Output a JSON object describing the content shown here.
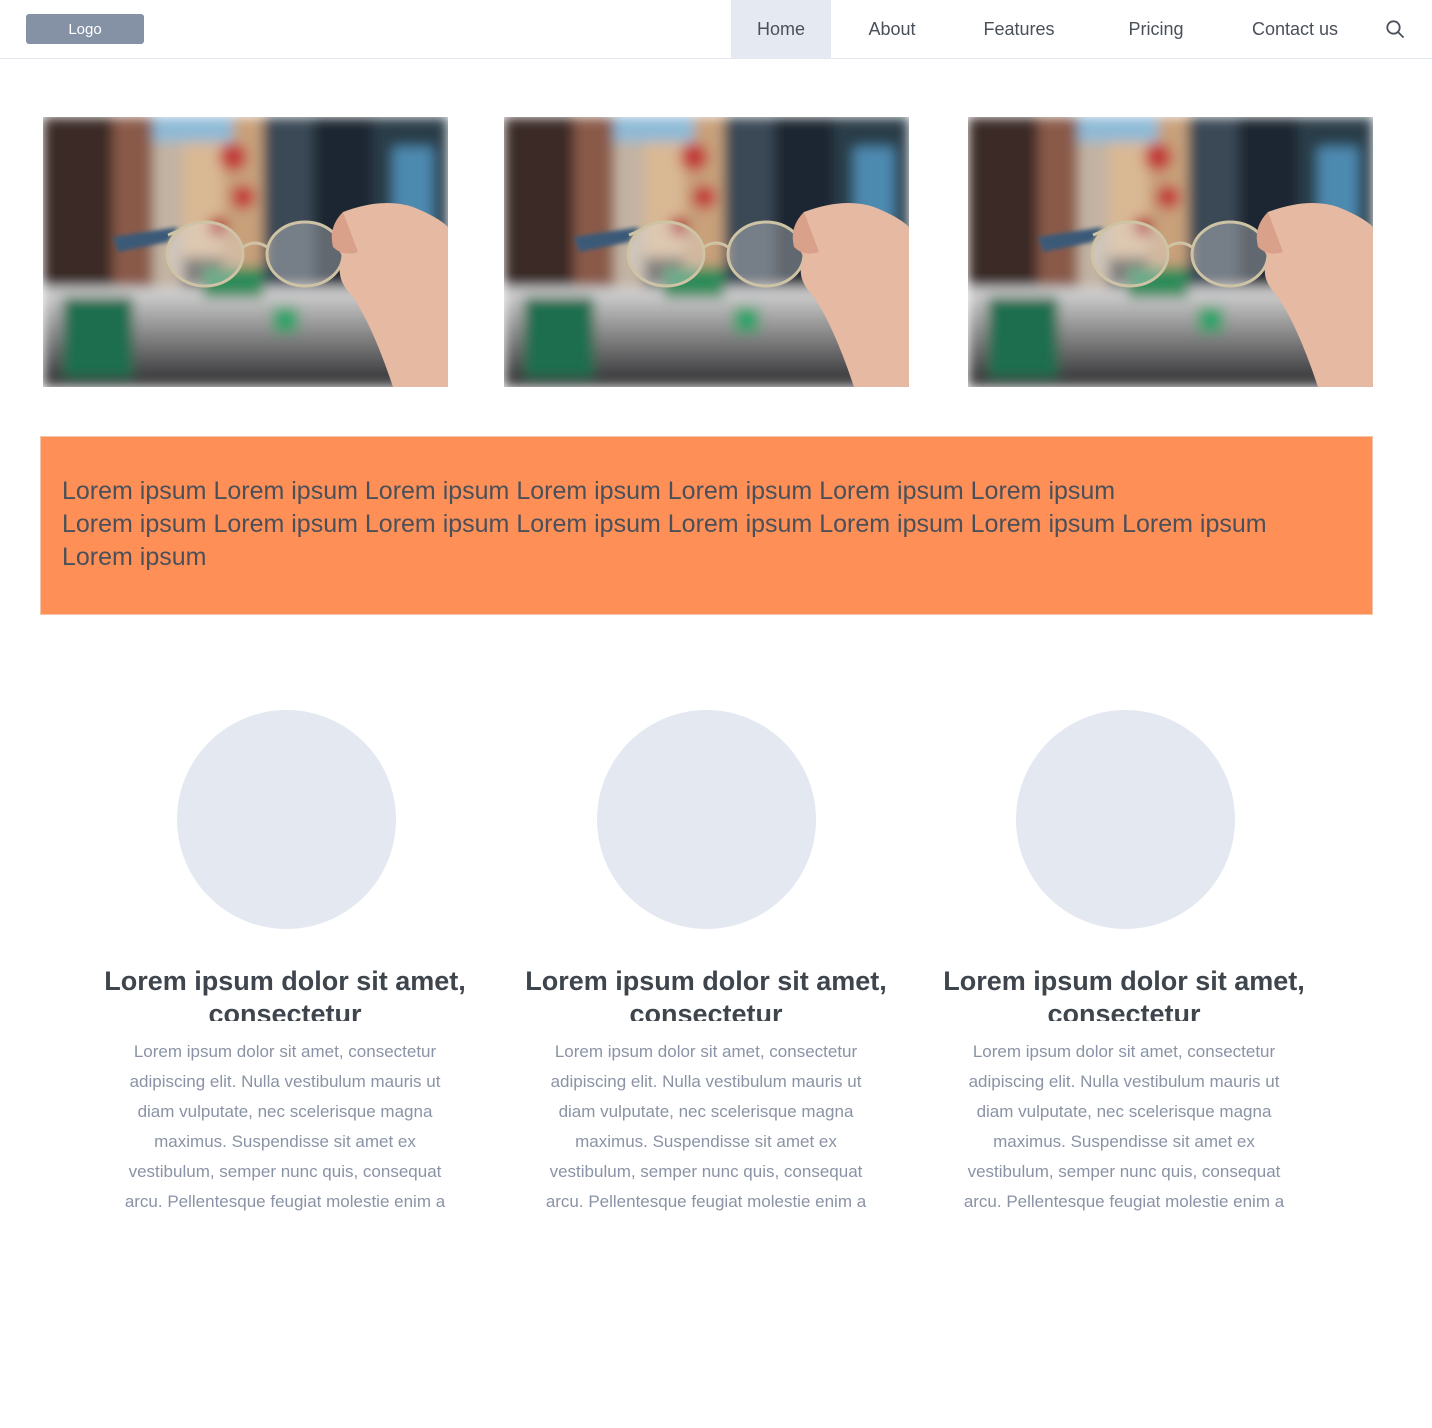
{
  "header": {
    "logo": "Logo",
    "nav": [
      {
        "label": "Home",
        "active": true
      },
      {
        "label": "About",
        "active": false
      },
      {
        "label": "Features",
        "active": false
      },
      {
        "label": "Pricing",
        "active": false
      },
      {
        "label": "Contact us",
        "active": false
      }
    ],
    "search_icon": "search-icon"
  },
  "photos": [
    {
      "subject": "hand holding eyeglasses over city street"
    },
    {
      "subject": "hand holding eyeglasses over city street"
    },
    {
      "subject": "hand holding eyeglasses over city street"
    }
  ],
  "banner": {
    "lines": [
      "Lorem ipsum Lorem ipsum Lorem ipsum Lorem ipsum Lorem ipsum Lorem ipsum Lorem ipsum",
      "Lorem ipsum Lorem ipsum Lorem ipsum Lorem ipsum Lorem ipsum Lorem ipsum Lorem ipsum Lorem ipsum",
      "Lorem ipsum"
    ],
    "color": "#fe8f57"
  },
  "features": [
    {
      "title": "Lorem ipsum dolor sit amet, consectetur",
      "text": "Lorem ipsum dolor sit amet, consectetur adipiscing elit. Nulla vestibulum mauris ut diam vulputate, nec scelerisque magna maximus. Suspendisse sit amet ex vestibulum, semper nunc quis, consequat arcu. Pellentesque feugiat molestie enim a"
    },
    {
      "title": "Lorem ipsum dolor sit amet, consectetur",
      "text": "Lorem ipsum dolor sit amet, consectetur adipiscing elit. Nulla vestibulum mauris ut diam vulputate, nec scelerisque magna maximus. Suspendisse sit amet ex vestibulum, semper nunc quis, consequat arcu. Pellentesque feugiat molestie enim a"
    },
    {
      "title": "Lorem ipsum dolor sit amet, consectetur",
      "text": "Lorem ipsum dolor sit amet, consectetur adipiscing elit. Nulla vestibulum mauris ut diam vulputate, nec scelerisque magna maximus. Suspendisse sit amet ex vestibulum, semper nunc quis, consequat arcu. Pellentesque feugiat molestie enim a"
    }
  ],
  "colors": {
    "nav_active_bg": "#e5e9f2",
    "logo_bg": "#8592a6",
    "circle": "#e4e8f1"
  }
}
